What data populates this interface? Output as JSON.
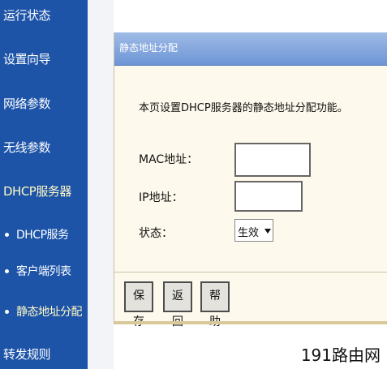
{
  "sidebar": {
    "items": [
      {
        "label": "运行状态"
      },
      {
        "label": "设置向导"
      },
      {
        "label": "网络参数"
      },
      {
        "label": "无线参数"
      },
      {
        "label": "DHCP服务器"
      },
      {
        "label": "DHCP服务"
      },
      {
        "label": "客户端列表"
      },
      {
        "label": "静态地址分配"
      },
      {
        "label": "转发规则"
      }
    ]
  },
  "panel": {
    "title": "静态地址分配",
    "description": "本页设置DHCP服务器的静态地址分配功能。",
    "mac_label": "MAC地址：",
    "mac_value": "",
    "ip_label": "IP地址：",
    "ip_value": "",
    "status_label": "状态：",
    "status_value": "生效"
  },
  "buttons": {
    "save": "保 存",
    "back": "返 回",
    "help": "帮 助"
  },
  "watermark": "191路由网",
  "colors": {
    "sidebar": "#1d54a8",
    "panel_header": "#7fa2dc",
    "panel_bg": "#fdf9ec"
  }
}
